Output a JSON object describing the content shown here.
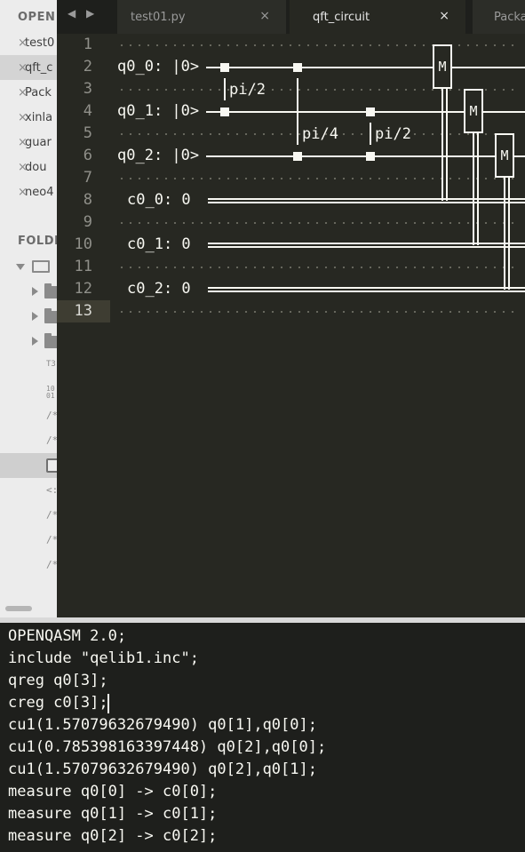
{
  "sidebar": {
    "open_files_heading": "OPEN",
    "open_files": [
      {
        "label": "test0",
        "close": "×"
      },
      {
        "label": "qft_c",
        "close": "×"
      },
      {
        "label": "Pack",
        "close": "×"
      },
      {
        "label": "xinla",
        "close": "×"
      },
      {
        "label": "guar",
        "close": "×"
      },
      {
        "label": "dou",
        "close": "×"
      },
      {
        "label": "neo4",
        "close": "×"
      }
    ],
    "folders_heading": "FOLDI",
    "tree_glyphs": [
      "T3",
      "10 01",
      "/*",
      "/*",
      "<:",
      "/*",
      "/*",
      "/*"
    ]
  },
  "tabs": {
    "nav_arrows": "◀ ▶",
    "items": [
      {
        "label": "test01.py",
        "close": "×"
      },
      {
        "label": "qft_circuit",
        "close": "×"
      },
      {
        "label": "Packa",
        "close": ""
      }
    ]
  },
  "editor": {
    "line_numbers": [
      "1",
      "2",
      "3",
      "4",
      "5",
      "6",
      "7",
      "8",
      "9",
      "10",
      "11",
      "12",
      "13"
    ],
    "qubit_labels": [
      "q0_0: |0>",
      "q0_1: |0>",
      "q0_2: |0>"
    ],
    "classical_labels": [
      "c0_0: 0",
      "c0_1: 0",
      "c0_2: 0"
    ],
    "gate_labels": [
      "pi/2",
      "pi/4",
      "pi/2"
    ],
    "measure_label": "M"
  },
  "console": {
    "lines": [
      "OPENQASM 2.0;",
      "include \"qelib1.inc\";",
      "qreg q0[3];",
      "creg c0[3];",
      "cu1(1.57079632679490) q0[1],q0[0];",
      "cu1(0.785398163397448) q0[2],q0[0];",
      "cu1(1.57079632679490) q0[2],q0[1];",
      "measure q0[0] -> c0[0];",
      "measure q0[1] -> c0[1];",
      "measure q0[2] -> c0[2];"
    ]
  }
}
